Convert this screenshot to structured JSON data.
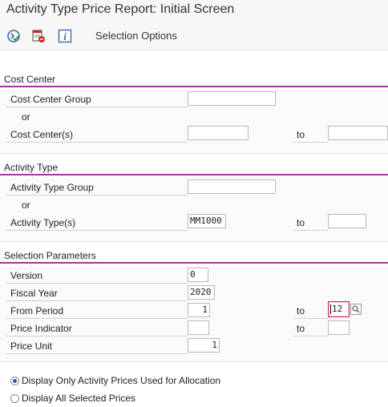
{
  "window": {
    "title": "Activity Type Price Report: Initial Screen"
  },
  "toolbar": {
    "execute_icon": "execute-icon",
    "delete_icon": "delete-variant-icon",
    "info_icon": "info-icon",
    "selection_options_label": "Selection Options"
  },
  "cost_center": {
    "header": "Cost Center",
    "group_label": "Cost Center Group",
    "group_value": "",
    "or_label": "or",
    "centers_label": "Cost Center(s)",
    "centers_from": "",
    "to_label": "to",
    "centers_to": ""
  },
  "activity_type": {
    "header": "Activity Type",
    "group_label": "Activity Type Group",
    "group_value": "",
    "or_label": "or",
    "types_label": "Activity Type(s)",
    "types_from": "MM1000",
    "to_label": "to",
    "types_to": ""
  },
  "selection_parameters": {
    "header": "Selection Parameters",
    "version_label": "Version",
    "version_value": "0",
    "fiscal_year_label": "Fiscal Year",
    "fiscal_year_value": "2020",
    "from_period_label": "From Period",
    "from_period_value": "1",
    "period_to_label": "to",
    "period_to_value": "12",
    "price_indicator_label": "Price Indicator",
    "price_indicator_value": "",
    "price_indicator_to_label": "to",
    "price_indicator_to_value": "",
    "price_unit_label": "Price Unit",
    "price_unit_value": "1"
  },
  "options": {
    "display_used_label": "Display Only Activity Prices Used for Allocation",
    "display_used_selected": true,
    "display_all_label": "Display All Selected Prices",
    "display_all_selected": false
  },
  "colors": {
    "section_rule": "#9b3ba0",
    "focus": "#d02060",
    "radio": "#2a5db0"
  }
}
